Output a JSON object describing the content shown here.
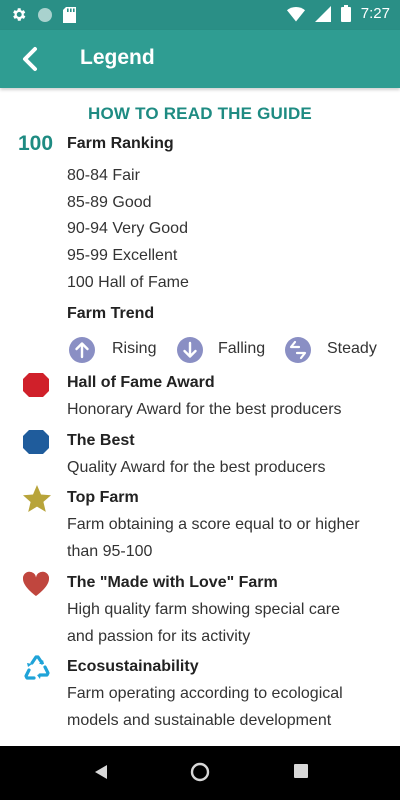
{
  "status": {
    "time": "7:27"
  },
  "appbar": {
    "title": "Legend"
  },
  "guide": {
    "heading": "HOW TO READ THE GUIDE",
    "ranking_number": "100",
    "ranking_label": "Farm Ranking",
    "ranking_items": [
      "80-84 Fair",
      "85-89 Good",
      "90-94 Very Good",
      "95-99 Excellent",
      "100 Hall of Fame"
    ],
    "trend_label": "Farm Trend",
    "trend": {
      "rising": "Rising",
      "falling": "Falling",
      "steady": "Steady"
    },
    "awards": [
      {
        "title": "Hall of Fame Award",
        "lines": [
          "Honorary Award for the best producers"
        ],
        "icon": "red-hexagon-icon",
        "color": "#d0202a"
      },
      {
        "title": "The Best",
        "lines": [
          "Quality Award for the best producers"
        ],
        "icon": "blue-hexagon-icon",
        "color": "#1f5c9c"
      },
      {
        "title": "Top Farm",
        "lines": [
          "Farm obtaining a score equal to or higher",
          "than 95-100"
        ],
        "icon": "gold-star-icon",
        "color": "#b8a43a"
      },
      {
        "title": "The \"Made with Love\" Farm",
        "lines": [
          "High quality farm showing special care",
          "and passion for its activity"
        ],
        "icon": "heart-icon",
        "color": "#c0463e"
      },
      {
        "title": "Ecosustainability",
        "lines": [
          "Farm operating according to ecological",
          "models and sustainable development"
        ],
        "icon": "recycle-icon",
        "color": "#1fa3d8"
      }
    ]
  },
  "colors": {
    "primary": "#2f9d92",
    "status": "#2a8f86",
    "accent_text": "#1e8b82",
    "trend_icon": "#8a8fc4"
  }
}
